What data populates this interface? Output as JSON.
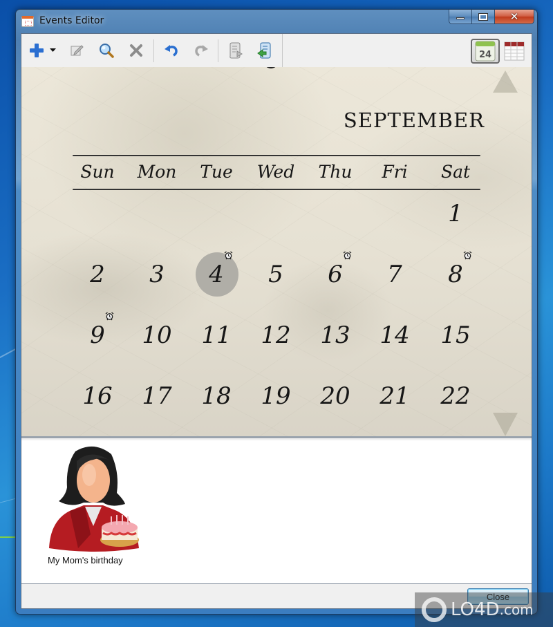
{
  "window": {
    "title": "Events Editor",
    "caption_buttons": {
      "minimize": "minimize",
      "maximize": "maximize",
      "close": "✕"
    }
  },
  "toolbar": {
    "buttons": [
      {
        "name": "add",
        "icon": "plus-icon",
        "tooltip": "Add"
      },
      {
        "name": "add-dropdown",
        "icon": "dropdown-arrow-icon"
      },
      {
        "name": "edit",
        "icon": "edit-icon"
      },
      {
        "name": "search",
        "icon": "magnifier-icon"
      },
      {
        "name": "delete",
        "icon": "delete-x-icon"
      },
      {
        "name": "undo",
        "icon": "undo-icon"
      },
      {
        "name": "redo",
        "icon": "redo-icon"
      },
      {
        "name": "export",
        "icon": "scroll-export-icon"
      },
      {
        "name": "import",
        "icon": "scroll-import-icon"
      }
    ],
    "views": [
      {
        "name": "calendar-view",
        "icon": "calendar-24-icon",
        "label": "24",
        "active": true
      },
      {
        "name": "table-view",
        "icon": "table-icon",
        "active": false
      }
    ]
  },
  "calendar": {
    "month": "SEPTEMBER",
    "weekdays": [
      "Sun",
      "Mon",
      "Tue",
      "Wed",
      "Thu",
      "Fri",
      "Sat"
    ],
    "first_weekday_index": 6,
    "days": [
      {
        "day": "1"
      },
      {
        "day": "2"
      },
      {
        "day": "3"
      },
      {
        "day": "4",
        "selected": true,
        "alarm": true
      },
      {
        "day": "5"
      },
      {
        "day": "6",
        "alarm": true
      },
      {
        "day": "7"
      },
      {
        "day": "8",
        "alarm": true
      },
      {
        "day": "9",
        "alarm": true
      },
      {
        "day": "10"
      },
      {
        "day": "11"
      },
      {
        "day": "12"
      },
      {
        "day": "13"
      },
      {
        "day": "14"
      },
      {
        "day": "15"
      },
      {
        "day": "16"
      },
      {
        "day": "17"
      },
      {
        "day": "18"
      },
      {
        "day": "19"
      },
      {
        "day": "20"
      },
      {
        "day": "21"
      },
      {
        "day": "22"
      }
    ],
    "scroll_up": "scroll-up",
    "scroll_down": "scroll-down"
  },
  "events": [
    {
      "label": "My Mom's birthday",
      "icon": "woman-with-birthday-cake-icon"
    }
  ],
  "footer": {
    "close_label": "Close"
  },
  "watermark": {
    "text": "LO4D",
    "suffix": ".com"
  },
  "colors": {
    "selected_day": "#b0aea7",
    "toolbar_bg": "#f0f0f0",
    "add_blue": "#2b6fd1"
  }
}
